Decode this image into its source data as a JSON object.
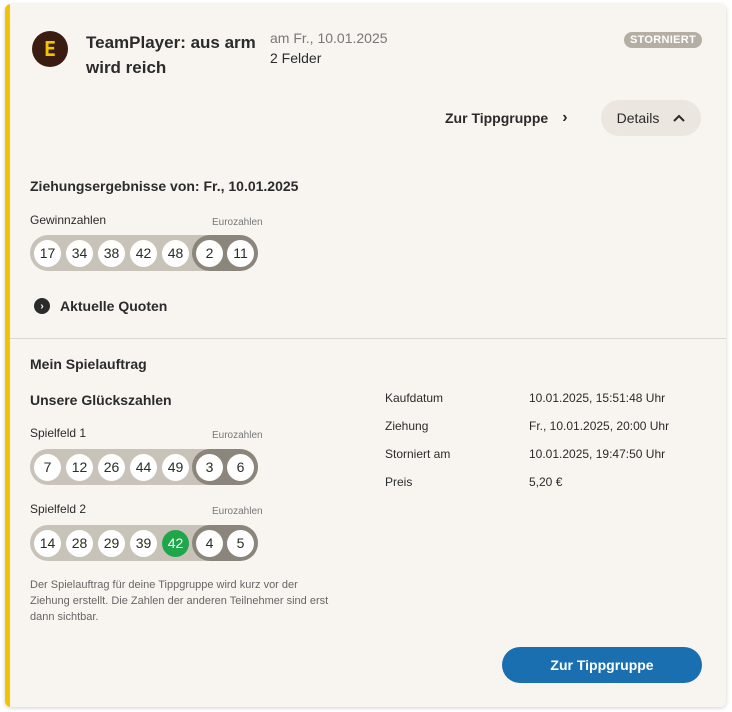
{
  "header": {
    "logo_letter": "E",
    "title": "TeamPlayer: aus arm wird reich",
    "date": "am Fr., 10.01.2025",
    "felder": "2 Felder",
    "badge": "STORNIERT"
  },
  "actions": {
    "tippgruppe_link": "Zur Tippgruppe",
    "details_label": "Details"
  },
  "ziehung": {
    "heading": "Ziehungsergebnisse von: Fr., 10.01.2025",
    "gewinnzahlen_label": "Gewinnzahlen",
    "eurozahlen_label": "Eurozahlen",
    "numbers": [
      "17",
      "34",
      "38",
      "42",
      "48"
    ],
    "euro": [
      "2",
      "11"
    ],
    "quoten_label": "Aktuelle Quoten"
  },
  "auftrag": {
    "heading": "Mein Spielauftrag",
    "glueck_heading": "Unsere Glückszahlen",
    "fields": [
      {
        "label": "Spielfeld 1",
        "euro_label": "Eurozahlen",
        "numbers": [
          "7",
          "12",
          "26",
          "44",
          "49"
        ],
        "euro": [
          "3",
          "6"
        ],
        "highlight": []
      },
      {
        "label": "Spielfeld 2",
        "euro_label": "Eurozahlen",
        "numbers": [
          "14",
          "28",
          "29",
          "39",
          "42"
        ],
        "euro": [
          "4",
          "5"
        ],
        "highlight": [
          "42"
        ]
      }
    ],
    "info": "Der Spielauftrag für deine Tippgruppe wird kurz vor der Ziehung erstellt. Die Zahlen der anderen Teilnehmer sind erst dann sichtbar.",
    "details": [
      {
        "key": "Kaufdatum",
        "value": "10.01.2025, 15:51:48 Uhr"
      },
      {
        "key": "Ziehung",
        "value": "Fr., 10.01.2025, 20:00 Uhr"
      },
      {
        "key": "Storniert am",
        "value": "10.01.2025, 19:47:50 Uhr"
      },
      {
        "key": "Preis",
        "value": "5,20 €"
      }
    ],
    "button": "Zur Tippgruppe"
  },
  "colors": {
    "accent_stripe": "#f2c300",
    "primary_button": "#1a6fb0",
    "match_ball": "#1fa64a",
    "badge": "#b5aea5"
  }
}
